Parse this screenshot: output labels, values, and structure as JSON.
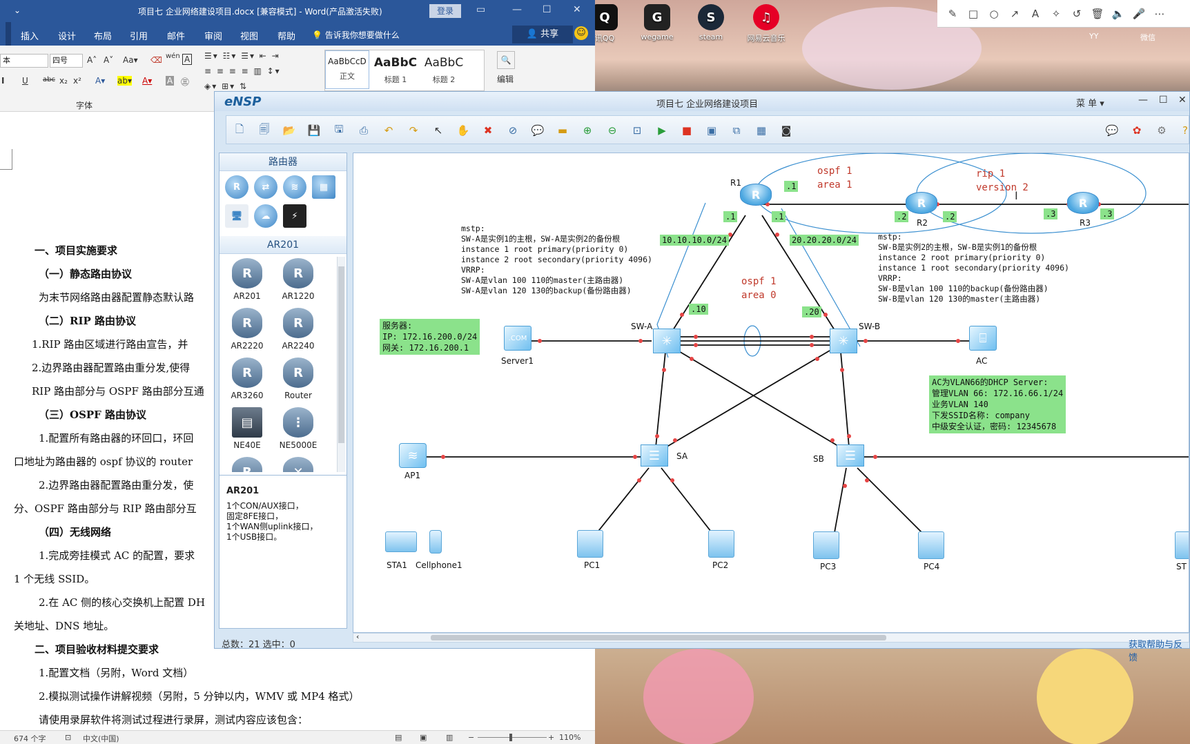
{
  "desktop": {
    "icons": [
      {
        "label": "讯QQ",
        "icon": "qq-icon",
        "color": "#111111"
      },
      {
        "label": "wegame",
        "icon": "wegame-icon",
        "color": "#222222"
      },
      {
        "label": "steam",
        "icon": "steam-icon",
        "color": "#1b2838"
      },
      {
        "label": "网易云音乐",
        "icon": "netease-music-icon",
        "color": "#e60026"
      }
    ],
    "user_labels": [
      "YY",
      "微信"
    ]
  },
  "word": {
    "title": "项目七 企业网络建设项目.docx [兼容模式] - Word(产品激活失败)",
    "login": "登录",
    "menu": [
      "插入",
      "设计",
      "布局",
      "引用",
      "邮件",
      "审阅",
      "视图",
      "帮助"
    ],
    "tell_me": "告诉我你想要做什么",
    "share": "共享",
    "font_name": "本",
    "font_size": "四号",
    "styles": [
      {
        "preview": "AaBbCcD",
        "name": "正文"
      },
      {
        "preview": "AaBbC",
        "name": "标题 1"
      },
      {
        "preview": "AaBbC",
        "name": "标题 2"
      }
    ],
    "edit_label": "编辑",
    "font_group": "字体",
    "document_lines": [
      "一、项目实施要求",
      "（一）静态路由协议",
      "为末节网络路由器配置静态默认路",
      "（二）RIP 路由协议",
      "1.RIP 路由区域进行路由宣告，并",
      "2.边界路由器配置路由重分发,使得",
      "RIP 路由部分与 OSPF 路由部分互通",
      "（三）OSPF 路由协议",
      "1.配置所有路由器的环回口，环回",
      "口地址为路由器的 ospf 协议的 router",
      "2.边界路由器配置路由重分发，使",
      "分、OSPF 路由部分与 RIP 路由部分互",
      "（四）无线网络",
      "1.完成旁挂模式 AC 的配置，要求",
      "1 个无线 SSID。",
      "2.在 AC 侧的核心交换机上配置 DH",
      "关地址、DNS 地址。",
      "二、项目验收材料提交要求",
      "1.配置文档（另附，Word 文档）",
      "2.模拟测试操作讲解视频（另附，5 分钟以内，WMV 或 MP4 格式）",
      "请使用录屏软件将测试过程进行录屏，测试内容应该包含："
    ],
    "status": {
      "words": "674 个字",
      "lang": "中文(中国)",
      "zoom": "110%"
    }
  },
  "ensp": {
    "logo": "eNSP",
    "title": "项目七 企业网络建设项目",
    "menu": "菜 单",
    "category_header": "路由器",
    "subcategory_header": "AR201",
    "devices": [
      "AR201",
      "AR1220",
      "AR2220",
      "AR2240",
      "AR3260",
      "Router",
      "NE40E",
      "NE5000E"
    ],
    "description_title": "AR201",
    "description": [
      "1个CON/AUX接口，",
      "固定8FE接口，",
      "1个WAN侧uplink接口，",
      "1个USB接口。"
    ],
    "status_left": "总数：21  选中：0",
    "status_right": "获取帮助与反馈",
    "topology": {
      "nodes": {
        "r1": "R1",
        "r2": "R2",
        "r3": "R3",
        "swa": "SW-A",
        "swb": "SW-B",
        "server1": "Server1",
        "ac": "AC",
        "ap1": "AP1",
        "sa": "SA",
        "sb": "SB",
        "sta1": "STA1",
        "cellphone1": "Cellphone1",
        "pc1": "PC1",
        "pc2": "PC2",
        "pc3": "PC3",
        "pc4": "PC4",
        "st": "ST"
      },
      "ip_labels": {
        "r1_top": ".1",
        "r1_left": ".1",
        "r1_right": ".1",
        "r2_left": ".2",
        "r2_right": ".2",
        "r3_left": ".3",
        "r3_right": ".3",
        "net1": "10.10.10.0/24",
        "net2": "20.20.20.0/24",
        "swa": ".10",
        "swb": ".20"
      },
      "ospf1": "ospf 1\narea 1",
      "rip1": "rip 1\nversion 2",
      "ospf0": "ospf 1\narea 0",
      "mstp_left": "mstp:\nSW-A是实例1的主根，SW-A是实例2的备份根\ninstance 1 root primary(priority 0)\ninstance 2 root secondary(priority 4096)\nVRRP:\nSW-A是vlan 100 110的master(主路由器)\nSW-A是vlan 120 130的backup(备份路由器)",
      "mstp_right": "mstp:\nSW-B是实例2的主根，SW-B是实例1的备份根\ninstance 2 root primary(priority 0)\ninstance 1 root secondary(priority 4096)\nVRRP:\nSW-B是vlan 100 110的backup(备份路由器)\nSW-B是vlan 120 130的master(主路由器)",
      "server_box": "服务器:\nIP: 172.16.200.0/24\n网关: 172.16.200.1",
      "ac_box": "AC为VLAN66的DHCP Server:\n管理VLAN 66: 172.16.66.1/24\n业务VLAN 140\n下发SSID名称: company\n中级安全认证，密码: 12345678"
    }
  }
}
